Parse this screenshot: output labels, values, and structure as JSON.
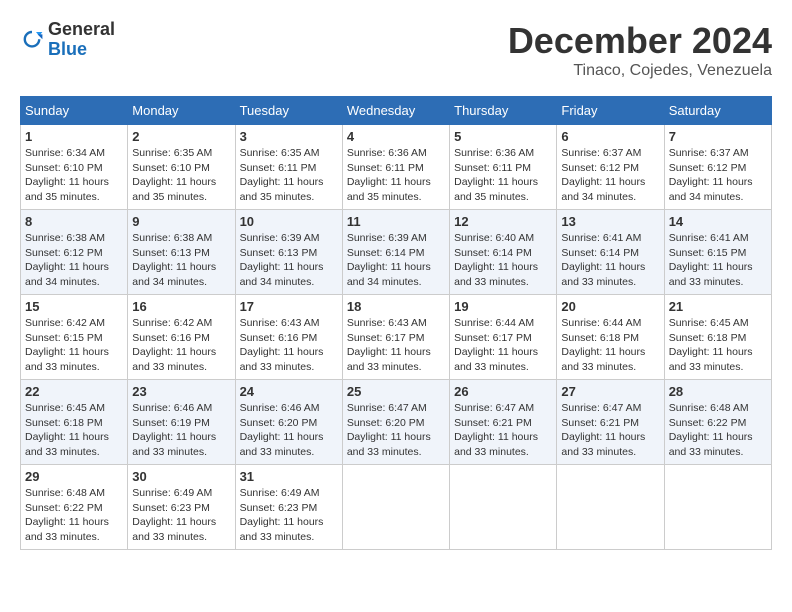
{
  "header": {
    "logo": {
      "general": "General",
      "blue": "Blue"
    },
    "title": "December 2024",
    "subtitle": "Tinaco, Cojedes, Venezuela"
  },
  "calendar": {
    "days_of_week": [
      "Sunday",
      "Monday",
      "Tuesday",
      "Wednesday",
      "Thursday",
      "Friday",
      "Saturday"
    ],
    "weeks": [
      [
        {
          "day": "1",
          "sunrise": "6:34 AM",
          "sunset": "6:10 PM",
          "daylight": "11 hours and 35 minutes."
        },
        {
          "day": "2",
          "sunrise": "6:35 AM",
          "sunset": "6:10 PM",
          "daylight": "11 hours and 35 minutes."
        },
        {
          "day": "3",
          "sunrise": "6:35 AM",
          "sunset": "6:11 PM",
          "daylight": "11 hours and 35 minutes."
        },
        {
          "day": "4",
          "sunrise": "6:36 AM",
          "sunset": "6:11 PM",
          "daylight": "11 hours and 35 minutes."
        },
        {
          "day": "5",
          "sunrise": "6:36 AM",
          "sunset": "6:11 PM",
          "daylight": "11 hours and 35 minutes."
        },
        {
          "day": "6",
          "sunrise": "6:37 AM",
          "sunset": "6:12 PM",
          "daylight": "11 hours and 34 minutes."
        },
        {
          "day": "7",
          "sunrise": "6:37 AM",
          "sunset": "6:12 PM",
          "daylight": "11 hours and 34 minutes."
        }
      ],
      [
        {
          "day": "8",
          "sunrise": "6:38 AM",
          "sunset": "6:12 PM",
          "daylight": "11 hours and 34 minutes."
        },
        {
          "day": "9",
          "sunrise": "6:38 AM",
          "sunset": "6:13 PM",
          "daylight": "11 hours and 34 minutes."
        },
        {
          "day": "10",
          "sunrise": "6:39 AM",
          "sunset": "6:13 PM",
          "daylight": "11 hours and 34 minutes."
        },
        {
          "day": "11",
          "sunrise": "6:39 AM",
          "sunset": "6:14 PM",
          "daylight": "11 hours and 34 minutes."
        },
        {
          "day": "12",
          "sunrise": "6:40 AM",
          "sunset": "6:14 PM",
          "daylight": "11 hours and 33 minutes."
        },
        {
          "day": "13",
          "sunrise": "6:41 AM",
          "sunset": "6:14 PM",
          "daylight": "11 hours and 33 minutes."
        },
        {
          "day": "14",
          "sunrise": "6:41 AM",
          "sunset": "6:15 PM",
          "daylight": "11 hours and 33 minutes."
        }
      ],
      [
        {
          "day": "15",
          "sunrise": "6:42 AM",
          "sunset": "6:15 PM",
          "daylight": "11 hours and 33 minutes."
        },
        {
          "day": "16",
          "sunrise": "6:42 AM",
          "sunset": "6:16 PM",
          "daylight": "11 hours and 33 minutes."
        },
        {
          "day": "17",
          "sunrise": "6:43 AM",
          "sunset": "6:16 PM",
          "daylight": "11 hours and 33 minutes."
        },
        {
          "day": "18",
          "sunrise": "6:43 AM",
          "sunset": "6:17 PM",
          "daylight": "11 hours and 33 minutes."
        },
        {
          "day": "19",
          "sunrise": "6:44 AM",
          "sunset": "6:17 PM",
          "daylight": "11 hours and 33 minutes."
        },
        {
          "day": "20",
          "sunrise": "6:44 AM",
          "sunset": "6:18 PM",
          "daylight": "11 hours and 33 minutes."
        },
        {
          "day": "21",
          "sunrise": "6:45 AM",
          "sunset": "6:18 PM",
          "daylight": "11 hours and 33 minutes."
        }
      ],
      [
        {
          "day": "22",
          "sunrise": "6:45 AM",
          "sunset": "6:18 PM",
          "daylight": "11 hours and 33 minutes."
        },
        {
          "day": "23",
          "sunrise": "6:46 AM",
          "sunset": "6:19 PM",
          "daylight": "11 hours and 33 minutes."
        },
        {
          "day": "24",
          "sunrise": "6:46 AM",
          "sunset": "6:20 PM",
          "daylight": "11 hours and 33 minutes."
        },
        {
          "day": "25",
          "sunrise": "6:47 AM",
          "sunset": "6:20 PM",
          "daylight": "11 hours and 33 minutes."
        },
        {
          "day": "26",
          "sunrise": "6:47 AM",
          "sunset": "6:21 PM",
          "daylight": "11 hours and 33 minutes."
        },
        {
          "day": "27",
          "sunrise": "6:47 AM",
          "sunset": "6:21 PM",
          "daylight": "11 hours and 33 minutes."
        },
        {
          "day": "28",
          "sunrise": "6:48 AM",
          "sunset": "6:22 PM",
          "daylight": "11 hours and 33 minutes."
        }
      ],
      [
        {
          "day": "29",
          "sunrise": "6:48 AM",
          "sunset": "6:22 PM",
          "daylight": "11 hours and 33 minutes."
        },
        {
          "day": "30",
          "sunrise": "6:49 AM",
          "sunset": "6:23 PM",
          "daylight": "11 hours and 33 minutes."
        },
        {
          "day": "31",
          "sunrise": "6:49 AM",
          "sunset": "6:23 PM",
          "daylight": "11 hours and 33 minutes."
        },
        null,
        null,
        null,
        null
      ]
    ]
  }
}
